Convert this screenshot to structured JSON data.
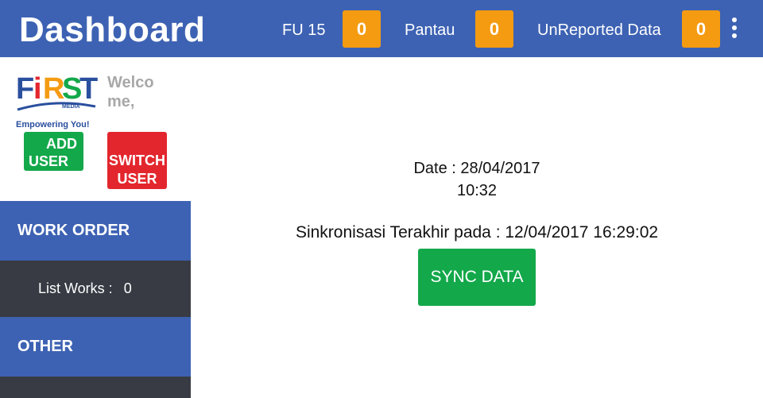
{
  "header": {
    "title": "Dashboard",
    "counters": [
      {
        "label": "FU 15",
        "value": "0"
      },
      {
        "label": "Pantau",
        "value": "0"
      },
      {
        "label": "UnReported Data",
        "value": "0"
      }
    ],
    "menu_icon": "more-vertical-icon"
  },
  "sidebar": {
    "logo": {
      "brand": "FiRST",
      "sub": "MEDIA",
      "tagline": "Empowering You!"
    },
    "welcome": "Welcome,",
    "add_user": {
      "line1": "ADD",
      "line2": "USER"
    },
    "switch_user": {
      "line1": "SWITCH",
      "line2": "USER"
    },
    "work_order": "WORK ORDER",
    "list_works": {
      "label": "List Works :",
      "value": "0"
    },
    "other": "OTHER"
  },
  "main": {
    "date": "Date : 28/04/2017",
    "time": "10:32",
    "last_sync": "Sinkronisasi Terakhir pada : 12/04/2017 16:29:02",
    "sync_button": "SYNC DATA"
  },
  "colors": {
    "primary": "#3d62b3",
    "dark": "#383b44",
    "badge": "#f59b12",
    "green": "#13a84a",
    "red": "#e3262d"
  }
}
